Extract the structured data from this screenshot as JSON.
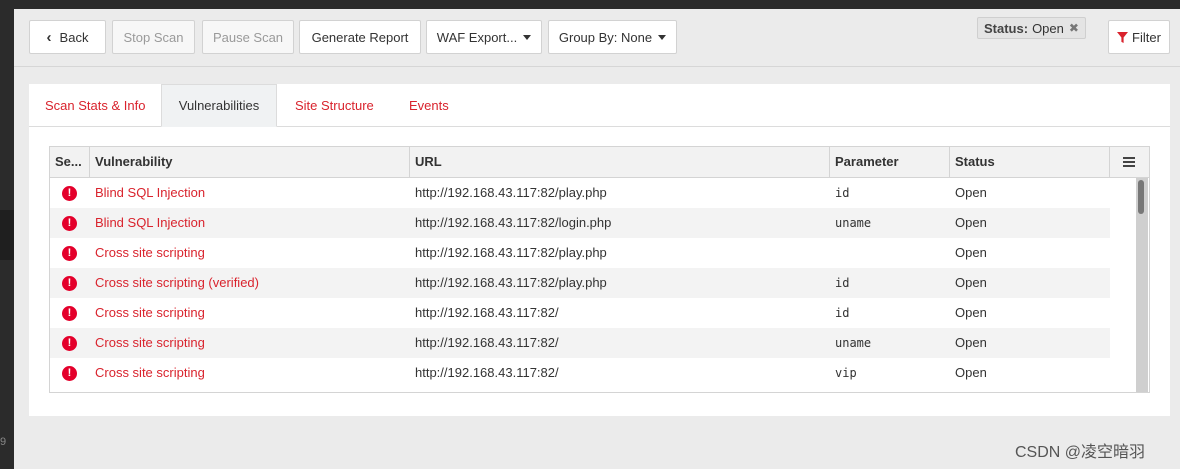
{
  "toolbar": {
    "back_label": "Back",
    "stop_scan_label": "Stop Scan",
    "pause_scan_label": "Pause Scan",
    "generate_report_label": "Generate Report",
    "waf_export_label": "WAF Export...",
    "group_by_label": "Group By: None",
    "filter_label": "Filter"
  },
  "status_filter": {
    "key": "Status:",
    "value": "Open"
  },
  "tabs": [
    {
      "label": "Scan Stats & Info"
    },
    {
      "label": "Vulnerabilities"
    },
    {
      "label": "Site Structure"
    },
    {
      "label": "Events"
    }
  ],
  "table": {
    "headers": [
      "Se...",
      "Vulnerability",
      "URL",
      "Parameter",
      "Status"
    ],
    "rows": [
      {
        "vulnerability": "Blind SQL Injection",
        "url": "http://192.168.43.117:82/play.php",
        "parameter": "id",
        "status": "Open"
      },
      {
        "vulnerability": "Blind SQL Injection",
        "url": "http://192.168.43.117:82/login.php",
        "parameter": "uname",
        "status": "Open"
      },
      {
        "vulnerability": "Cross site scripting",
        "url": "http://192.168.43.117:82/play.php",
        "parameter": "",
        "status": "Open"
      },
      {
        "vulnerability": "Cross site scripting (verified)",
        "url": "http://192.168.43.117:82/play.php",
        "parameter": "id",
        "status": "Open"
      },
      {
        "vulnerability": "Cross site scripting",
        "url": "http://192.168.43.117:82/",
        "parameter": "id",
        "status": "Open"
      },
      {
        "vulnerability": "Cross site scripting",
        "url": "http://192.168.43.117:82/",
        "parameter": "uname",
        "status": "Open"
      },
      {
        "vulnerability": "Cross site scripting",
        "url": "http://192.168.43.117:82/",
        "parameter": "vip",
        "status": "Open"
      }
    ]
  },
  "watermark": "CSDN @凌空暗羽",
  "side_number": "9",
  "colors": {
    "accent": "#d9232d",
    "severity_high": "#e4002b"
  },
  "icons": {
    "back": "chevron-left-icon",
    "severity": "exclamation-circle-icon",
    "filter": "funnel-icon",
    "remove": "close-icon",
    "menu": "hamburger-icon"
  }
}
